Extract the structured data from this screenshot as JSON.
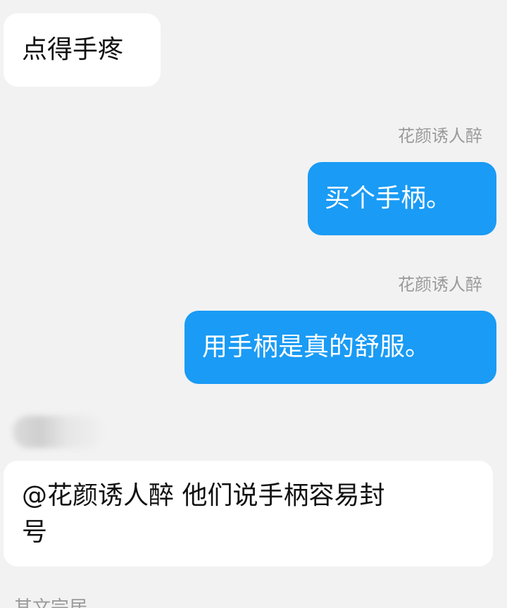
{
  "messages": [
    {
      "direction": "incoming",
      "sender": "",
      "text": "点得手疼"
    },
    {
      "direction": "outgoing",
      "sender": "花颜诱人醉",
      "text": "买个手柄。"
    },
    {
      "direction": "outgoing",
      "sender": "花颜诱人醉",
      "text": "用手柄是真的舒服。"
    },
    {
      "direction": "incoming",
      "sender": "",
      "text_lines": [
        "@花颜诱人醉 他们说手柄容易封",
        "号"
      ]
    }
  ],
  "footer": {
    "partial_text": "其文完居"
  },
  "colors": {
    "background": "#f2f2f2",
    "incoming_bubble": "#ffffff",
    "outgoing_bubble": "#1a9bf5",
    "sender_name": "#9a9a9a"
  }
}
